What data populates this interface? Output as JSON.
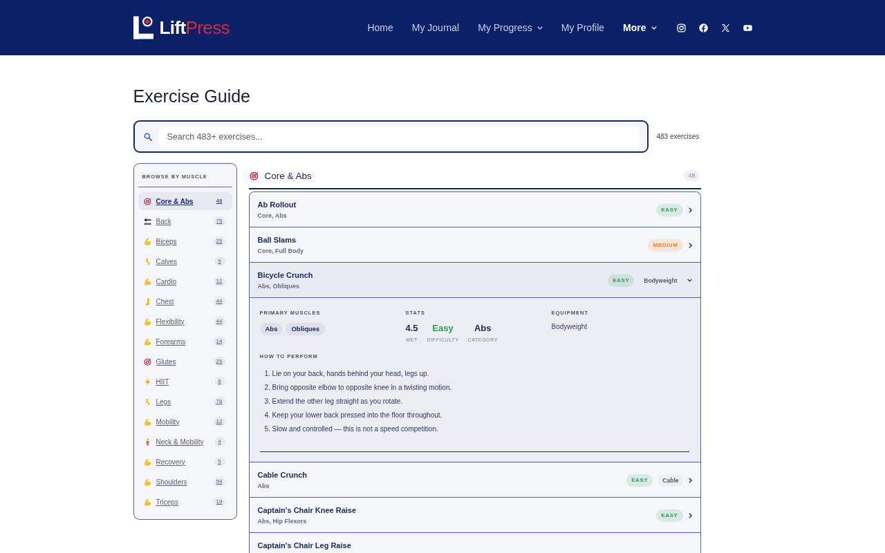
{
  "header": {
    "brand": {
      "parts": [
        "Lift",
        "Press"
      ]
    },
    "nav": [
      {
        "label": "Home",
        "has_menu": false,
        "selected": false
      },
      {
        "label": "My Journal",
        "has_menu": false,
        "selected": false
      },
      {
        "label": "My Progress",
        "has_menu": true,
        "selected": false
      },
      {
        "label": "My Profile",
        "has_menu": false,
        "selected": false
      },
      {
        "label": "More",
        "has_menu": true,
        "selected": true
      }
    ]
  },
  "page": {
    "title": "Exercise Guide"
  },
  "search": {
    "placeholder": "Search 483+ exercises...",
    "result_count": "483 exercises"
  },
  "sidebar": {
    "heading": "BROWSE BY MUSCLE",
    "items": [
      {
        "label": "Core & Abs",
        "count": "48",
        "kind": "target",
        "selected": true
      },
      {
        "label": "Back",
        "count": "75",
        "kind": "back",
        "selected": false
      },
      {
        "label": "Biceps",
        "count": "25",
        "kind": "arm",
        "selected": false
      },
      {
        "label": "Calves",
        "count": "9",
        "kind": "leg",
        "selected": false
      },
      {
        "label": "Cardio",
        "count": "12",
        "kind": "arm",
        "selected": false
      },
      {
        "label": "Chest",
        "count": "44",
        "kind": "foot",
        "selected": false
      },
      {
        "label": "Flexibility",
        "count": "44",
        "kind": "arm",
        "selected": false
      },
      {
        "label": "Forearms",
        "count": "14",
        "kind": "arm",
        "selected": false
      },
      {
        "label": "Glutes",
        "count": "29",
        "kind": "target",
        "selected": false
      },
      {
        "label": "HIIT",
        "count": "6",
        "kind": "bolt",
        "selected": false
      },
      {
        "label": "Legs",
        "count": "78",
        "kind": "leg",
        "selected": false
      },
      {
        "label": "Mobility",
        "count": "12",
        "kind": "arm",
        "selected": false
      },
      {
        "label": "Neck & Mobility",
        "count": "4",
        "kind": "person",
        "selected": false
      },
      {
        "label": "Recovery",
        "count": "5",
        "kind": "arm",
        "selected": false
      },
      {
        "label": "Shoulders",
        "count": "59",
        "kind": "arm",
        "selected": false
      },
      {
        "label": "Triceps",
        "count": "19",
        "kind": "arm",
        "selected": false
      }
    ]
  },
  "section": {
    "title": "Core & Abs",
    "count": "48"
  },
  "rows": [
    {
      "name": "Ab Rollout",
      "muscles": "Core, Abs",
      "difficulty": {
        "text": "EASY",
        "color": "#2f9e5c"
      },
      "expanded": false
    },
    {
      "name": "Ball Slams",
      "muscles": "Core, Full Body",
      "difficulty": {
        "text": "MEDIUM",
        "color": "#e5852a"
      },
      "expanded": false
    },
    {
      "name": "Bicycle Crunch",
      "muscles": "Abs, Obliques",
      "difficulty": {
        "text": "EASY",
        "color": "#2f9e5c"
      },
      "equipment": "Bodyweight",
      "expanded": true,
      "details": {
        "muscles_label": "PRIMARY MUSCLES",
        "muscles": [
          "Abs",
          "Obliques"
        ],
        "stats_label": "STATS",
        "stats": [
          {
            "value": "4.5",
            "label": "MET",
            "color": "#1c2657"
          },
          {
            "value": "Easy",
            "label": "DIFFICULTY",
            "color": "#2f9e5c"
          },
          {
            "value": "Abs",
            "label": "CATEGORY",
            "color": "#1c2657"
          }
        ],
        "equipment_label": "EQUIPMENT",
        "equipment": "Bodyweight",
        "steps_label": "HOW TO PERFORM",
        "steps": [
          "1. Lie on your back, hands behind your head, legs up.",
          "2. Bring opposite elbow to opposite knee in a twisting motion.",
          "3. Extend the other leg straight as you rotate.",
          "4. Keep your lower back pressed into the floor throughout.",
          "5. Slow and controlled — this is not a speed competition."
        ]
      }
    },
    {
      "name": "Cable Crunch",
      "muscles": "Abs",
      "difficulty": {
        "text": "EASY",
        "color": "#2f9e5c"
      },
      "equipment": "Cable",
      "expanded": false
    },
    {
      "name": "Captain's Chair Knee Raise",
      "muscles": "Abs, Hip Flexors",
      "difficulty": {
        "text": "EASY",
        "color": "#2f9e5c"
      },
      "expanded": false
    },
    {
      "name": "Captain's Chair Leg Raise"
    }
  ]
}
